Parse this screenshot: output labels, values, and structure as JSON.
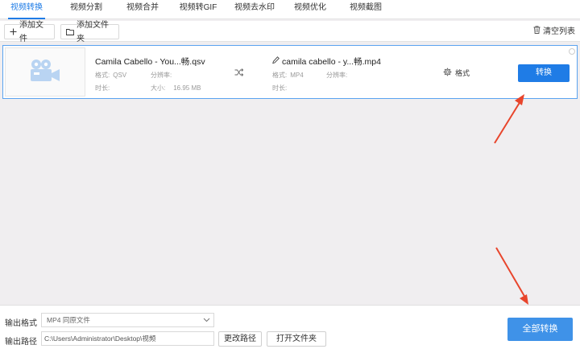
{
  "tabs": [
    {
      "label": "视频转换",
      "active": true
    },
    {
      "label": "视频分割",
      "active": false
    },
    {
      "label": "视频合并",
      "active": false
    },
    {
      "label": "视频转GIF",
      "active": false
    },
    {
      "label": "视频去水印",
      "active": false
    },
    {
      "label": "视频优化",
      "active": false
    },
    {
      "label": "视频截图",
      "active": false
    }
  ],
  "toolbar": {
    "add_file": "添加文件",
    "add_folder": "添加文件夹",
    "clear_list": "清空列表"
  },
  "file": {
    "source_name": "Camila Cabello - You...畅.qsv",
    "source_format_label": "格式:",
    "source_format": "QSV",
    "source_resolution_label": "分辨率:",
    "source_resolution": "",
    "source_duration_label": "时长:",
    "source_duration": "",
    "source_size_label": "大小:",
    "source_size": "16.95 MB",
    "target_name": "camila cabello - y...畅.mp4",
    "target_format_label": "格式:",
    "target_format": "MP4",
    "target_resolution_label": "分辨率:",
    "target_resolution": "",
    "target_duration_label": "时长:",
    "target_duration": "",
    "format_setting": "格式",
    "convert": "转换"
  },
  "bottom": {
    "output_format_label": "输出格式",
    "output_format_value": "MP4  同原文件",
    "output_path_label": "输出路径",
    "output_path_value": "C:\\Users\\Administrator\\Desktop\\视频",
    "change_path": "更改路径",
    "open_folder": "打开文件夹",
    "convert_all": "全部转换"
  },
  "colors": {
    "accent": "#1f7ce6",
    "arrow": "#e8452c"
  },
  "icons": [
    "plus-icon",
    "folder-icon",
    "trash-icon",
    "video-camera-icon",
    "shuffle-icon",
    "pencil-icon",
    "gear-icon",
    "chevron-down-icon"
  ]
}
